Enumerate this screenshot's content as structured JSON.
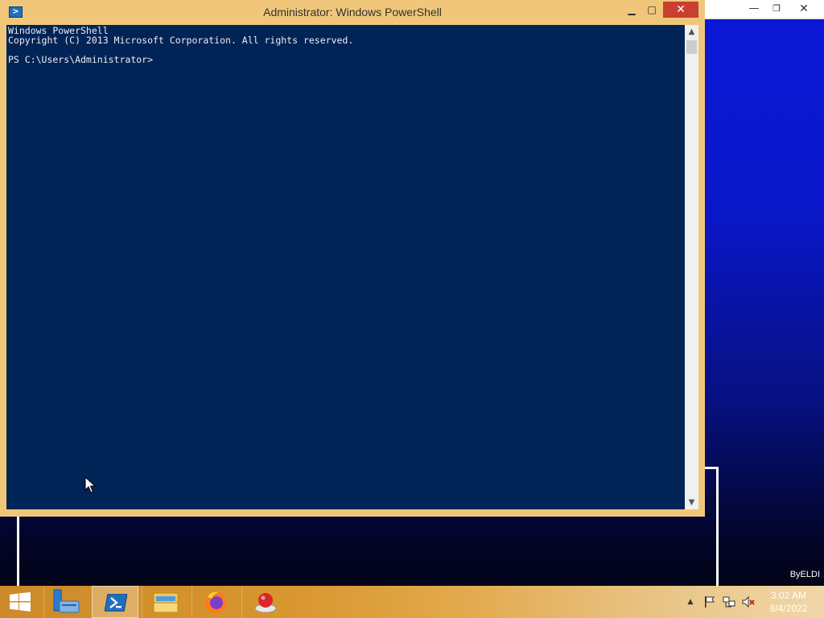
{
  "window": {
    "title": "Administrator: Windows PowerShell",
    "controls": {
      "minimize": "▁",
      "maximize": "□",
      "close": "✕"
    }
  },
  "console": {
    "lines": [
      "Windows PowerShell",
      "Copyright (C) 2013 Microsoft Corporation. All rights reserved.",
      "",
      "PS C:\\Users\\Administrator>"
    ]
  },
  "background_window": {
    "controls": {
      "minimize": "—",
      "restore": "❐",
      "close": "✕"
    }
  },
  "desktop": {
    "watermark": "ByELDI"
  },
  "taskbar": {
    "items": [
      {
        "name": "start",
        "icon": "windows-logo-icon"
      },
      {
        "name": "server-manager",
        "icon": "server-manager-icon"
      },
      {
        "name": "powershell",
        "icon": "powershell-icon",
        "active": true
      },
      {
        "name": "file-explorer",
        "icon": "folder-icon"
      },
      {
        "name": "firefox",
        "icon": "firefox-icon"
      },
      {
        "name": "app5",
        "icon": "red-ball-app-icon"
      }
    ],
    "tray": {
      "chevron": "▲",
      "time": "3:02 AM",
      "date": "8/4/2022"
    }
  },
  "colors": {
    "console_bg": "#012456",
    "window_frame": "#f0c77a",
    "close_button": "#c8402f",
    "taskbar_start": "#cc8a2a"
  }
}
